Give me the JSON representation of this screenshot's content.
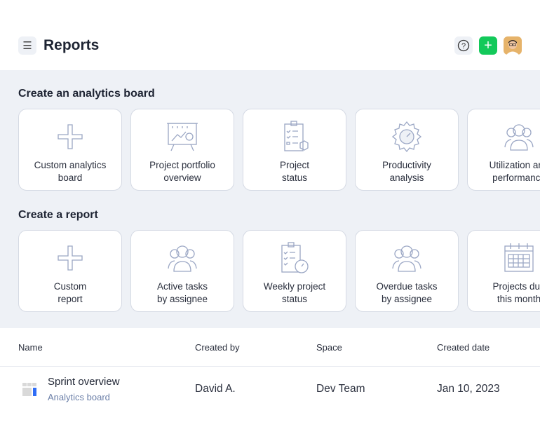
{
  "header": {
    "title": "Reports",
    "menu_icon": "hamburger-icon",
    "help_icon": "question-icon",
    "add_icon": "plus-icon",
    "add_color": "#13c95a"
  },
  "analytics": {
    "title": "Create an analytics board",
    "cards": [
      {
        "label": "Custom analytics\nboard",
        "icon": "plus-icon"
      },
      {
        "label": "Project portfolio\noverview",
        "icon": "presentation-chart-icon"
      },
      {
        "label": "Project\nstatus",
        "icon": "clipboard-checklist-icon"
      },
      {
        "label": "Productivity\nanalysis",
        "icon": "gear-gauge-icon"
      },
      {
        "label": "Utilization and\nperformance",
        "icon": "team-icon"
      }
    ]
  },
  "reports": {
    "title": "Create a report",
    "cards": [
      {
        "label": "Custom\nreport",
        "icon": "plus-icon"
      },
      {
        "label": "Active tasks\nby assignee",
        "icon": "team-icon"
      },
      {
        "label": "Weekly project\nstatus",
        "icon": "clipboard-clock-icon"
      },
      {
        "label": "Overdue tasks\nby assignee",
        "icon": "team-icon"
      },
      {
        "label": "Projects due\nthis month",
        "icon": "calendar-icon"
      }
    ]
  },
  "table": {
    "headers": [
      "Name",
      "Created by",
      "Space",
      "Created date"
    ],
    "rows": [
      {
        "name": "Sprint overview",
        "type": "Analytics board",
        "created_by": "David A.",
        "space": "Dev Team",
        "created_date": "Jan 10, 2023"
      }
    ]
  }
}
